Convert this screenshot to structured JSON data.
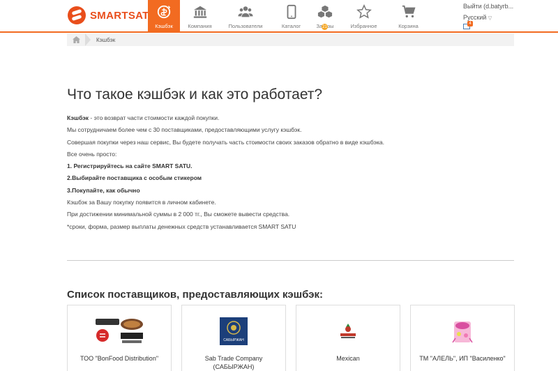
{
  "header": {
    "logo_text": "SMARTSATU",
    "nav": [
      {
        "label": "Кэшбэк",
        "icon": "cashback-icon",
        "active": true
      },
      {
        "label": "Компания",
        "icon": "bank-icon"
      },
      {
        "label": "Пользователи",
        "icon": "users-icon"
      },
      {
        "label": "Каталог",
        "icon": "tablet-icon"
      },
      {
        "label": "Заказы",
        "icon": "boxes-icon",
        "badge": "21"
      },
      {
        "label": "Избранное",
        "icon": "star-icon"
      },
      {
        "label": "Корзина",
        "icon": "cart-icon"
      }
    ],
    "account": "Выйти (d.batyrb...",
    "language": "Русский",
    "mail_badge": "4",
    "accent_color": "#f26b21"
  },
  "breadcrumb": {
    "current": "Кэшбэк"
  },
  "page_title": "Что такое кэшбэк и как это работает?",
  "intro": {
    "term": "Кэшбэк",
    "definition": " - это возврат части стоимости каждой покупки.",
    "lines": [
      "Мы сотрудничаем более чем с 30 поставщиками, предоставляющими услугу кэшбэк.",
      "Совершая покупки через наш сервис, Вы будете получать часть стоимости своих заказов обратно в виде кэшбэка.",
      "Все очень просто:"
    ],
    "steps": [
      "1. Регистрируйтесь на сайте SMART SATU.",
      "2.Выбирайте поставщика с особым стикером",
      "3.Покупайте, как обычно"
    ],
    "notes": [
      "Кэшбэк за Вашу покупку появится в личном кабинете.",
      "При достижении минимальной суммы в 2 000 тг., Вы сможете вывести средства.",
      "*сроки, форма, размер выплаты денежных средств устанавливается SMART SATU"
    ]
  },
  "suppliers": {
    "title": "Список поставщиков, предоставляющих кэшбэк:",
    "items": [
      {
        "name": "ТОО \"BonFood Distribution\"",
        "logo": "bonfood-logo"
      },
      {
        "name": "Sab Trade Company (САБЫРЖАН)",
        "logo": "sabyrzhan-logo",
        "logo_text": "САБЫРЖАН"
      },
      {
        "name": "Mexican",
        "logo": "mexican-logo"
      },
      {
        "name": "ТМ \"АЛЕЛЬ\", ИП \"Василенко\"",
        "logo": "alel-logo"
      }
    ]
  }
}
